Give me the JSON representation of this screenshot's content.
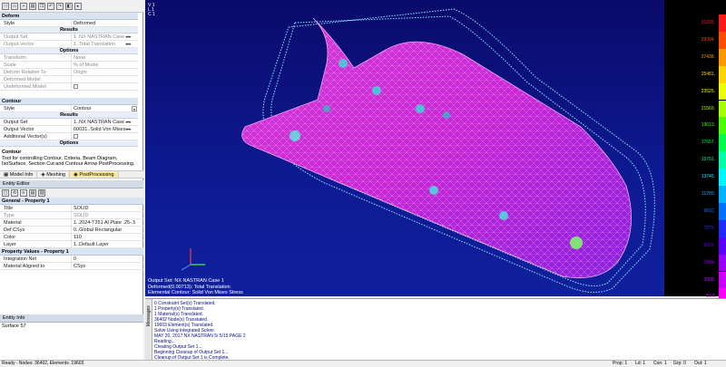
{
  "toolbar": {
    "icons": [
      "new-icon",
      "open-icon",
      "save-icon",
      "print-icon",
      "copy-icon",
      "undo-icon",
      "redo-icon",
      "view-icon",
      "arrow-icon"
    ]
  },
  "deform": {
    "header": "Deform",
    "style_label": "Style",
    "style_value": "Deformed",
    "results_header": "Results",
    "output_set_label": "Output Set",
    "output_set_value": "1..NX NASTRAN Case",
    "output_vector_label": "Output Vector",
    "output_vector_value": "1..Total Translation",
    "options_header": "Options",
    "transform_label": "Transform",
    "transform_value": "None",
    "scale_label": "Scale",
    "scale_value": "% of Model",
    "deform_relative_label": "Deform Relative To",
    "deform_relative_value": "Origin",
    "deformed_model_label": "Deformed Model",
    "undeformed_model_label": "Undeformed Model"
  },
  "contour": {
    "header": "Contour",
    "style_label": "Style",
    "style_value": "Contour",
    "results_header": "Results",
    "output_set_label": "Output Set",
    "output_set_value": "1..NX NASTRAN Case",
    "output_vector_label": "Output Vector",
    "output_vector_value": "60031..Solid Von Mises",
    "additional_label": "Additional Vector(s)",
    "options_header": "Options"
  },
  "help": {
    "title": "Contour",
    "text": "Tool for controlling Contour, Criteria, Beam Diagram, IsoSurface, Section Cut and Contour Arrow PostProcessing."
  },
  "tabs": [
    {
      "label": "Model Info",
      "icon": "model-info-icon"
    },
    {
      "label": "Meshing",
      "icon": "meshing-icon"
    },
    {
      "label": "PostProcessing",
      "icon": "postprocessing-icon"
    }
  ],
  "entity_editor": {
    "title": "Entity Editor",
    "general_header": "General - Property 1",
    "title_label": "Title",
    "title_value": "SOLID",
    "type_label": "Type",
    "type_value": "SOLID",
    "material_label": "Material",
    "material_value": "1..2024-T351 Al Plate .25-.5",
    "defcsys_label": "Def CSys",
    "defcsys_value": "0..Global Rectangular",
    "color_label": "Color",
    "color_value": "110",
    "layer_label": "Layer",
    "layer_value": "1..Default Layer",
    "propvals_header": "Property Values - Property 1",
    "integration_label": "Integration Net",
    "integration_value": "0",
    "aligned_label": "Material Aligned to",
    "aligned_value": "CSys"
  },
  "entity_info": {
    "title": "Entity Info",
    "text": "Surface 57"
  },
  "viewport": {
    "view_label": [
      "V 1",
      "L 1",
      "C 1"
    ],
    "line1": "Output Set: NX NASTRAN Case 1",
    "line2": "Deformed(0.00713): Total Translation",
    "line3": "Elemental Contour: Solid Von Mises Stress"
  },
  "legend": {
    "values": [
      "31205.",
      "29394.",
      "27438.",
      "25481.",
      "23525.",
      "21569.",
      "19613.",
      "17657.",
      "15701.",
      "13745.",
      "11789.",
      "9832.",
      "7876.",
      "5920.",
      "3964.",
      "2008.",
      "51.6"
    ],
    "colors": [
      "#ff1a1a",
      "#ff4d00",
      "#ff9900",
      "#ffd400",
      "#eaff00",
      "#a8ff00",
      "#4cff00",
      "#00ff4c",
      "#00ffaa",
      "#00f5ff",
      "#00b4ff",
      "#0072ff",
      "#1f2bff",
      "#5a00ff",
      "#9900ff",
      "#cc00ff",
      "#ff00ff"
    ]
  },
  "messages": {
    "tab_label": "Messages",
    "lines": [
      "0 Constraint Set(s) Translated.",
      "1 Property(s) Translated.",
      "1 Material(s) Translated.",
      "36402 Node(s) Translated.",
      "19603 Element(s) Translated.",
      "Solve Using integrated Solver.",
      "MAY 20, 2017  NX NASTRAN  5/ 5/15   PAGE    2",
      "Reading...",
      "Creating Output Set 1...",
      "Beginning Cleanup of Output Set 1...",
      "Cleanup of Output Set 1 is Complete."
    ]
  },
  "status": {
    "left": "Ready - Nodes: 36402, Elements: 19603",
    "prop": "Prop: 1",
    "ld": "Ld: 1",
    "con": "Con: 1",
    "grp": "Grp: 0",
    "out": "Out: 1"
  }
}
